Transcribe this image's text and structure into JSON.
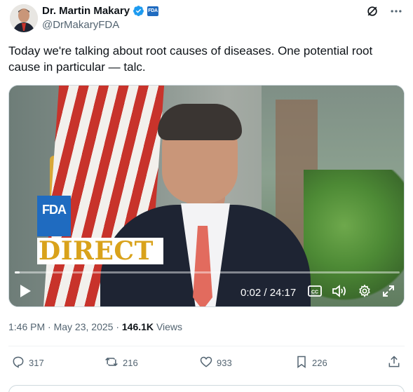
{
  "author": {
    "name": "Dr. Martin Makary",
    "handle": "@DrMakaryFDA",
    "badge_text": "FDA",
    "verified_color": "#1d9bf0"
  },
  "tweet": {
    "text": "Today we're talking about root causes of diseases. One potential root cause in particular — talc."
  },
  "video": {
    "overlay_logo": "FDA",
    "overlay_title": "DIRECT",
    "time_display": "0:02 / 24:17",
    "progress": 0.0014
  },
  "meta": {
    "time": "1:46 PM",
    "date": "May 23, 2025",
    "views_count": "146.1K",
    "views_label": "Views"
  },
  "actions": {
    "replies": "317",
    "reposts": "216",
    "likes": "933",
    "bookmarks": "226"
  },
  "icons": {
    "header": [
      "grok-icon",
      "more-icon"
    ],
    "controls": [
      "play-icon",
      "captions-icon",
      "volume-icon",
      "settings-icon",
      "fullscreen-icon"
    ],
    "actions": [
      "reply-icon",
      "repost-icon",
      "like-icon",
      "bookmark-icon",
      "share-icon"
    ]
  },
  "colors": {
    "text_primary": "#0f1419",
    "text_secondary": "#536471",
    "fda_blue": "#1f6bc0",
    "direct_gold": "#d9a21b"
  }
}
